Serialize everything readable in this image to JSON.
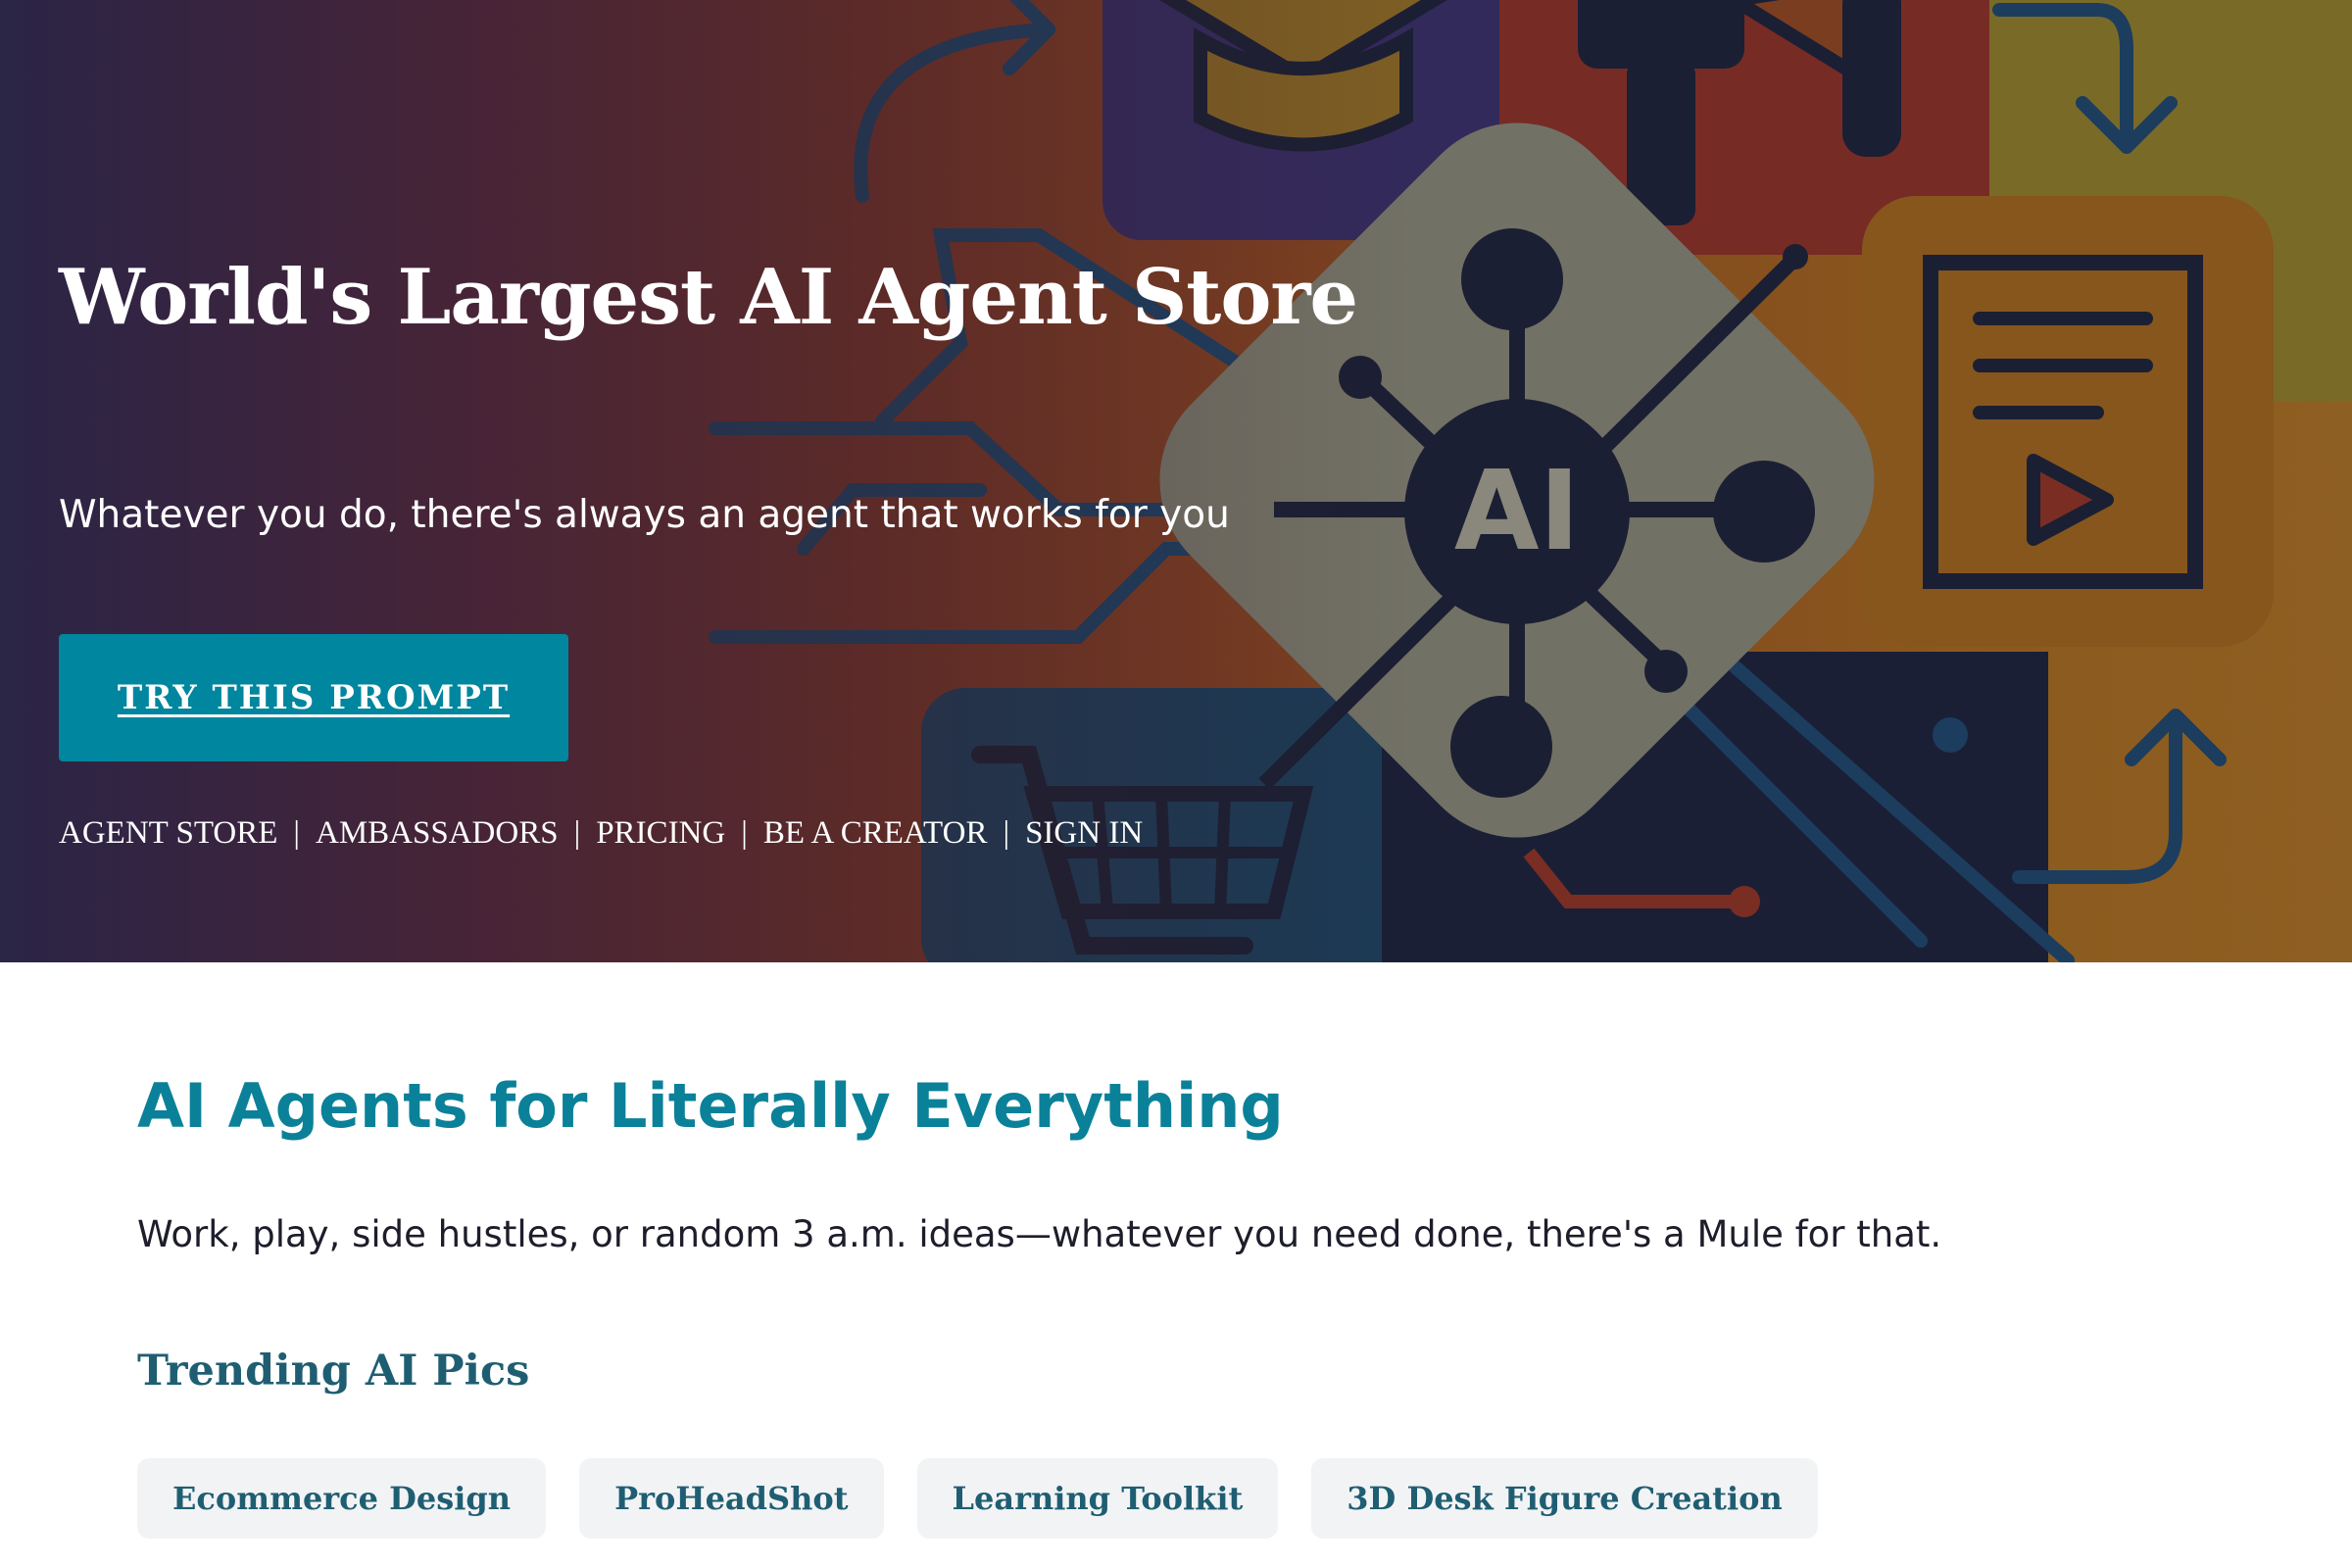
{
  "hero": {
    "title": "World's Largest AI Agent Store",
    "subtitle": "Whatever you do, there's always an agent that works for you",
    "cta_label": "TRY THIS PROMPT",
    "nav": [
      {
        "label": "AGENT STORE"
      },
      {
        "label": "AMBASSADORS"
      },
      {
        "label": "PRICING"
      },
      {
        "label": "BE A CREATOR"
      },
      {
        "label": "SIGN IN"
      }
    ],
    "nav_separator": "|",
    "art_badge": "AI",
    "icons": [
      "graduation-cap-icon",
      "megaphone-icon",
      "document-play-icon",
      "shopping-cart-icon",
      "ai-network-icon",
      "arrow-icon"
    ]
  },
  "main": {
    "title": "AI Agents for Literally Everything",
    "description": "Work, play, side hustles, or random 3 a.m. ideas—whatever you need done, there's a Mule for that.",
    "trending_title": "Trending AI Pics",
    "trending_chips": [
      {
        "label": "Ecommerce Design"
      },
      {
        "label": "ProHeadShot"
      },
      {
        "label": "Learning Toolkit"
      },
      {
        "label": "3D Desk Figure Creation"
      }
    ]
  },
  "colors": {
    "accent": "#00869e",
    "heading_teal": "#0a8199",
    "chip_text": "#1f5e72",
    "chip_bg": "#f2f3f5"
  }
}
